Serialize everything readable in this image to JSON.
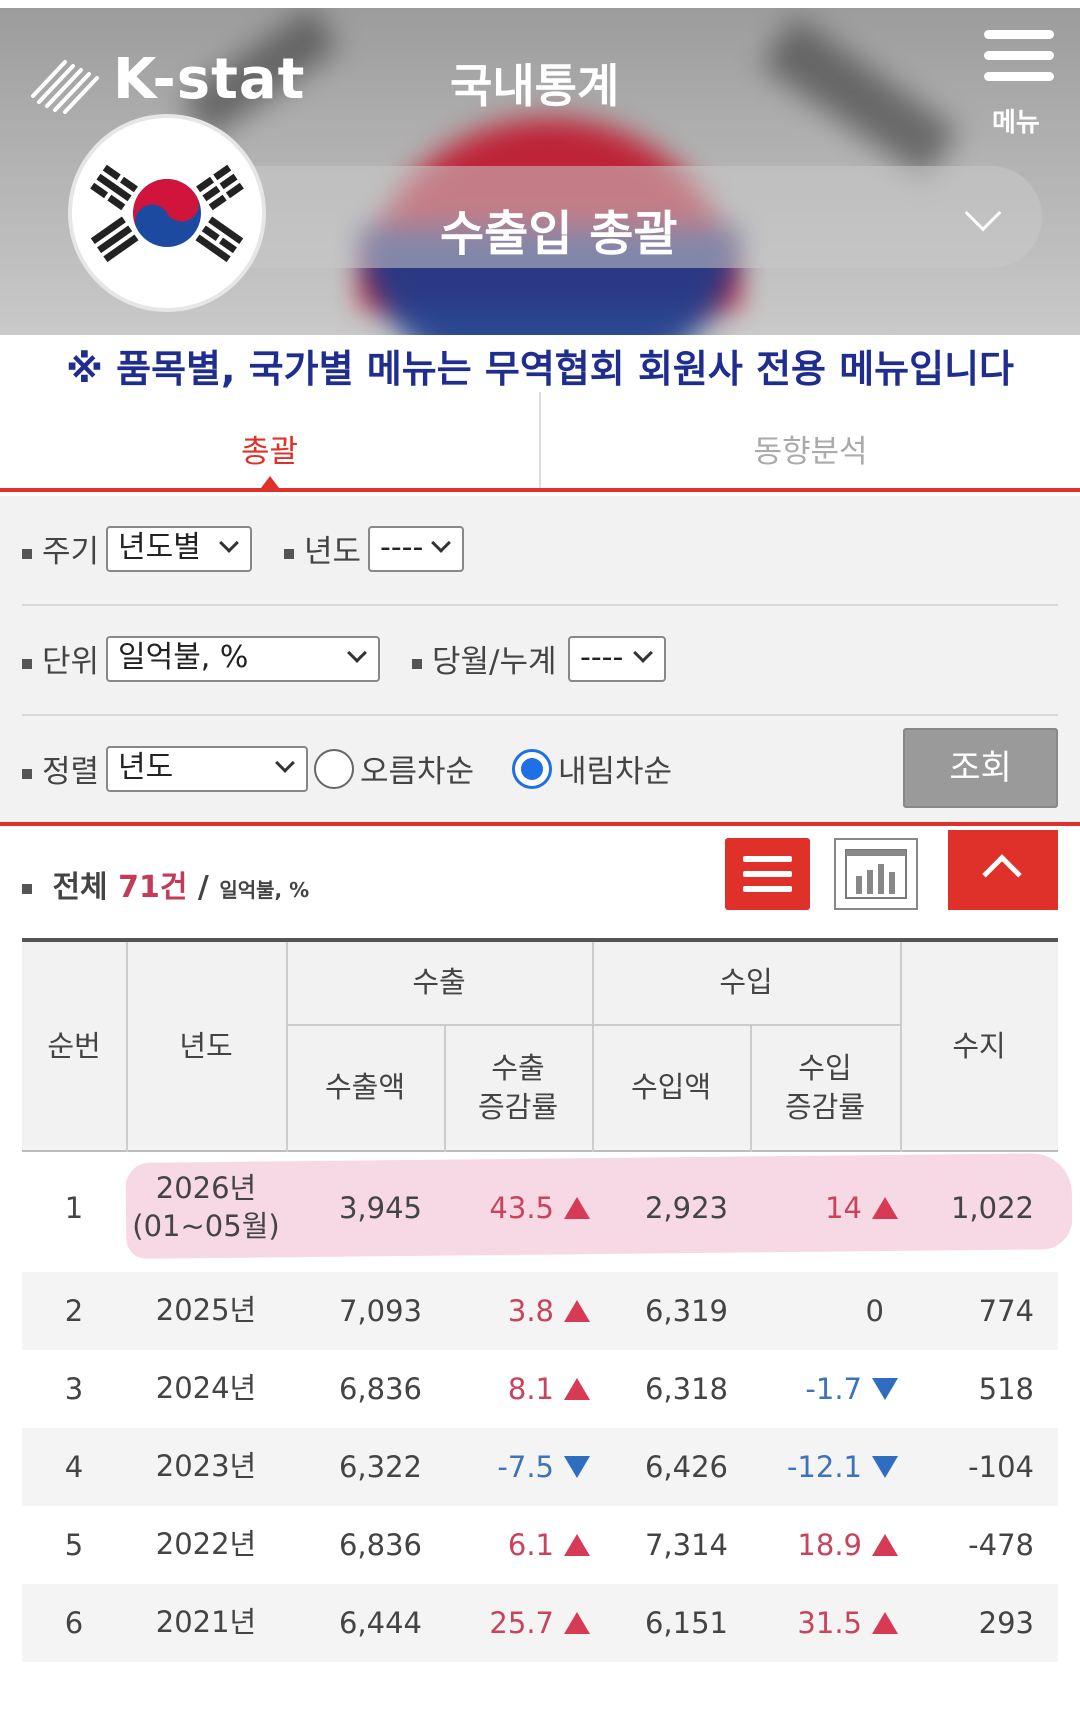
{
  "header": {
    "logo_text": "K-stat",
    "title": "국내통계",
    "menu_label": "메뉴",
    "select_value": "수출입 총괄"
  },
  "notice": "※ 품목별, 국가별 메뉴는 무역협회 회원사 전용 메뉴입니다",
  "tabs": [
    {
      "label": "총괄",
      "active": true
    },
    {
      "label": "동향분석",
      "active": false
    }
  ],
  "filter": {
    "period_label": "주기",
    "period_value": "년도별",
    "year_label": "년도",
    "year_value": "----",
    "unit_label": "단위",
    "unit_value": "일억불, %",
    "month_label": "당월/누계",
    "month_value": "----",
    "sort_label": "정렬",
    "sort_value": "년도",
    "asc_label": "오름차순",
    "desc_label": "내림차순",
    "selected_order": "desc",
    "query_label": "조회"
  },
  "summary": {
    "total_prefix": "전체",
    "count": "71건",
    "slash": "/",
    "unit": "일억불, %"
  },
  "table": {
    "headers": {
      "no": "순번",
      "year": "년도",
      "export_group": "수출",
      "import_group": "수입",
      "export_amount": "수출액",
      "export_rate": "수출\n증감률",
      "import_amount": "수입액",
      "import_rate": "수입\n증감률",
      "balance": "수지"
    },
    "rows": [
      {
        "no": "1",
        "year": "2026년",
        "year_sub": "(01~05월)",
        "export": "3,945",
        "export_rate": "43.5",
        "export_dir": "up",
        "import": "2,923",
        "import_rate": "14",
        "import_dir": "up",
        "balance": "1,022"
      },
      {
        "no": "2",
        "year": "2025년",
        "year_sub": "",
        "export": "7,093",
        "export_rate": "3.8",
        "export_dir": "up",
        "import": "6,319",
        "import_rate": "0",
        "import_dir": "none",
        "balance": "774"
      },
      {
        "no": "3",
        "year": "2024년",
        "year_sub": "",
        "export": "6,836",
        "export_rate": "8.1",
        "export_dir": "up",
        "import": "6,318",
        "import_rate": "-1.7",
        "import_dir": "down",
        "balance": "518"
      },
      {
        "no": "4",
        "year": "2023년",
        "year_sub": "",
        "export": "6,322",
        "export_rate": "-7.5",
        "export_dir": "down",
        "import": "6,426",
        "import_rate": "-12.1",
        "import_dir": "down",
        "balance": "-104"
      },
      {
        "no": "5",
        "year": "2022년",
        "year_sub": "",
        "export": "6,836",
        "export_rate": "6.1",
        "export_dir": "up",
        "import": "7,314",
        "import_rate": "18.9",
        "import_dir": "up",
        "balance": "-478"
      },
      {
        "no": "6",
        "year": "2021년",
        "year_sub": "",
        "export": "6,444",
        "export_rate": "25.7",
        "export_dir": "up",
        "import": "6,151",
        "import_rate": "31.5",
        "import_dir": "up",
        "balance": "293"
      }
    ]
  },
  "colors": {
    "accent": "#e0302a",
    "increase": "#c8435e",
    "decrease": "#3b74b8",
    "notice": "#1f2d8f"
  }
}
